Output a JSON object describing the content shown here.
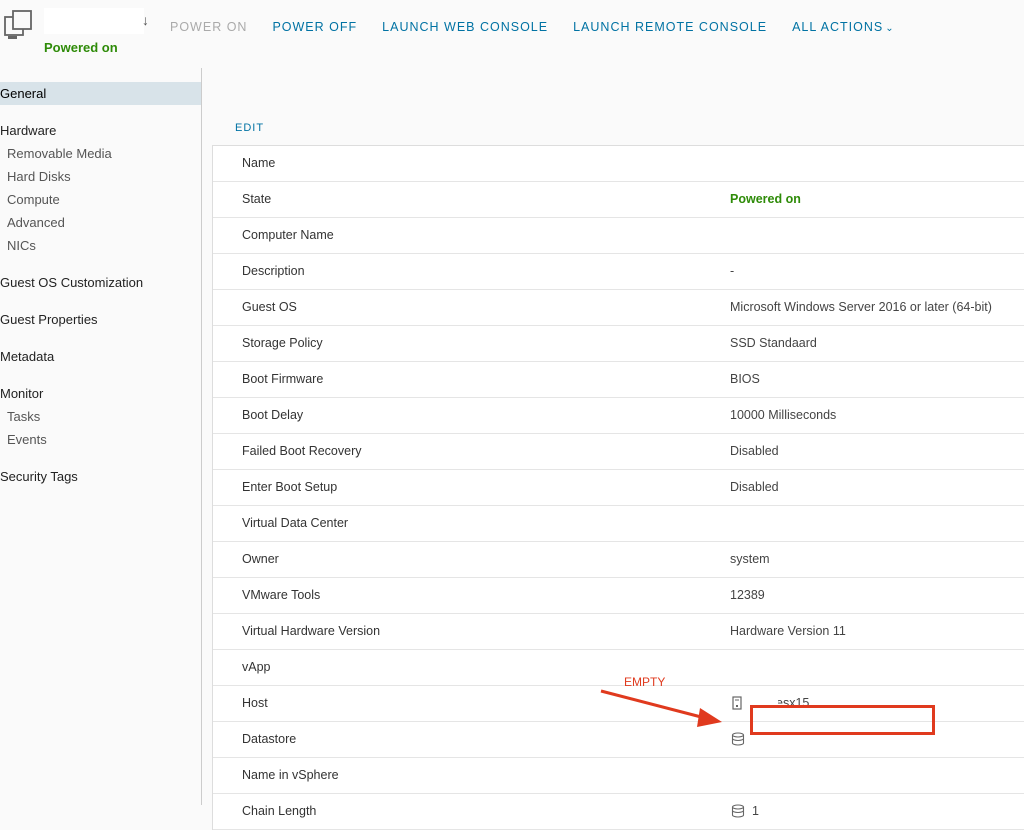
{
  "header": {
    "vm_name_trailing": "↓",
    "status": "Powered on",
    "actions": {
      "power_on": "POWER ON",
      "power_off": "POWER OFF",
      "launch_web_console": "LAUNCH WEB CONSOLE",
      "launch_remote_console": "LAUNCH REMOTE CONSOLE",
      "all_actions": "ALL ACTIONS"
    }
  },
  "sidebar": {
    "items": [
      {
        "label": "General",
        "selected": true
      },
      {
        "label": "Hardware"
      },
      {
        "label": "Removable Media"
      },
      {
        "label": "Hard Disks"
      },
      {
        "label": "Compute"
      },
      {
        "label": "Advanced"
      },
      {
        "label": "NICs"
      },
      {
        "label": "Guest OS Customization"
      },
      {
        "label": "Guest Properties"
      },
      {
        "label": "Metadata"
      },
      {
        "label": "Monitor"
      },
      {
        "label": "Tasks"
      },
      {
        "label": "Events"
      },
      {
        "label": "Security Tags"
      }
    ]
  },
  "main": {
    "edit_label": "EDIT",
    "rows": [
      {
        "label": "Name",
        "value": ""
      },
      {
        "label": "State",
        "value": "Powered on"
      },
      {
        "label": "Computer Name",
        "value": ""
      },
      {
        "label": "Description",
        "value": "-"
      },
      {
        "label": "Guest OS",
        "value": "Microsoft Windows Server 2016 or later (64-bit)"
      },
      {
        "label": "Storage Policy",
        "value": "SSD Standaard"
      },
      {
        "label": "Boot Firmware",
        "value": "BIOS"
      },
      {
        "label": "Boot Delay",
        "value": "10000 Milliseconds"
      },
      {
        "label": "Failed Boot Recovery",
        "value": "Disabled"
      },
      {
        "label": "Enter Boot Setup",
        "value": "Disabled"
      },
      {
        "label": "Virtual Data Center",
        "value": ""
      },
      {
        "label": "Owner",
        "value": "system"
      },
      {
        "label": "VMware Tools",
        "value": "12389"
      },
      {
        "label": "Virtual Hardware Version",
        "value": "Hardware Version 11"
      },
      {
        "label": "vApp",
        "value": ""
      },
      {
        "label": "Host",
        "value": "esx15."
      },
      {
        "label": "Datastore",
        "value": ""
      },
      {
        "label": "Name in vSphere",
        "value": ""
      },
      {
        "label": "Chain Length",
        "value": "1"
      }
    ]
  },
  "annotation": {
    "label": "EMPTY",
    "color": "#e03a1e"
  },
  "colors": {
    "accent": "#0072a3",
    "status_green": "#2e8b08",
    "selected_bg": "#d8e3e9"
  }
}
